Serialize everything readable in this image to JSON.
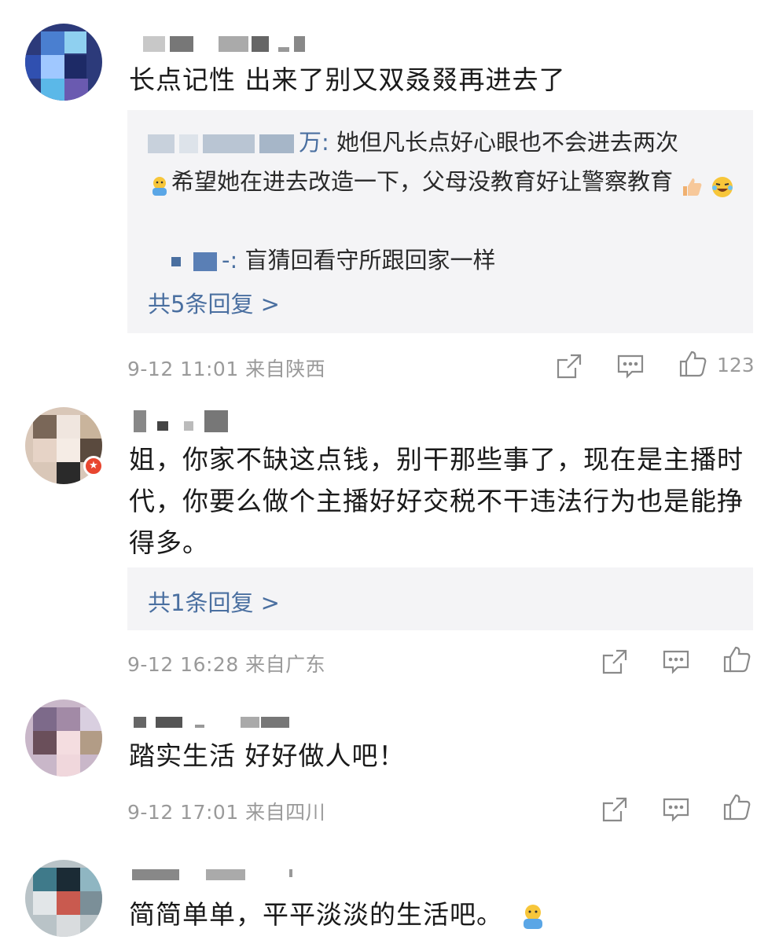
{
  "comments": [
    {
      "text": "长点记性 出来了别又双叒叕再进去了",
      "replies": [
        {
          "author_suffix": "万:",
          "text": "她但凡长点好心眼也不会进去两次"
        },
        {
          "text": "希望她在进去改造一下，父母没教育好让警察教育"
        },
        {
          "author_suffix": "-:",
          "text": "盲猜回看守所跟回家一样"
        }
      ],
      "more_replies": "共5条回复 >",
      "date": "9-12 11:01 来自陕西",
      "likes": "123"
    },
    {
      "text": "姐，你家不缺这点钱，别干那些事了，现在是主播时代，你要么做个主播好好交税不干违法行为也是能挣得多。",
      "more_replies": "共1条回复 >",
      "date": "9-12 16:28 来自广东",
      "likes": ""
    },
    {
      "text": "踏实生活 好好做人吧！",
      "date": "9-12 17:01 来自四川",
      "likes": ""
    },
    {
      "text": "简简单单，平平淡淡的生活吧。",
      "date": "",
      "likes": ""
    }
  ],
  "icons": {
    "repost": "share-icon",
    "comment": "comment-icon",
    "like": "thumbs-up-icon",
    "verified": "verified-badge-icon",
    "emoji": "emoji-icon"
  },
  "colors": {
    "link": "#4a6fa0",
    "meta": "#9a9a9a",
    "reply_bg": "#f4f4f6",
    "badge": "#e8462f"
  }
}
